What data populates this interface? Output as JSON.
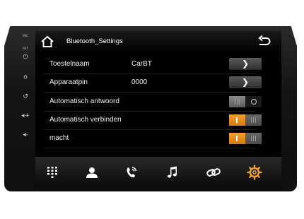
{
  "header": {
    "title": "Bluetooth_Settings"
  },
  "side_buttons": {
    "mic_label": "MIC",
    "rst_label": "RST",
    "items": [
      "power-icon",
      "home-icon",
      "back-icon",
      "volume-up-icon",
      "volume-down-icon"
    ]
  },
  "settings": {
    "rows": [
      {
        "label": "Toestelnaam",
        "value": "CarBT",
        "control": "arrow"
      },
      {
        "label": "Apparaatpin",
        "value": "0000",
        "control": "arrow"
      },
      {
        "label": "Automatisch antwoord",
        "control": "toggle",
        "state": "off"
      },
      {
        "label": "Automatisch verbinden",
        "control": "toggle",
        "state": "on"
      },
      {
        "label": "macht",
        "control": "toggle",
        "state": "on"
      }
    ],
    "arrow_glyph": "❯",
    "toggle_on_color": "#e68a1c"
  },
  "bottom_nav": {
    "items": [
      "dialpad-icon",
      "contacts-icon",
      "call-log-icon",
      "music-icon",
      "link-icon",
      "settings-icon"
    ],
    "active_color": "#f0a030"
  }
}
